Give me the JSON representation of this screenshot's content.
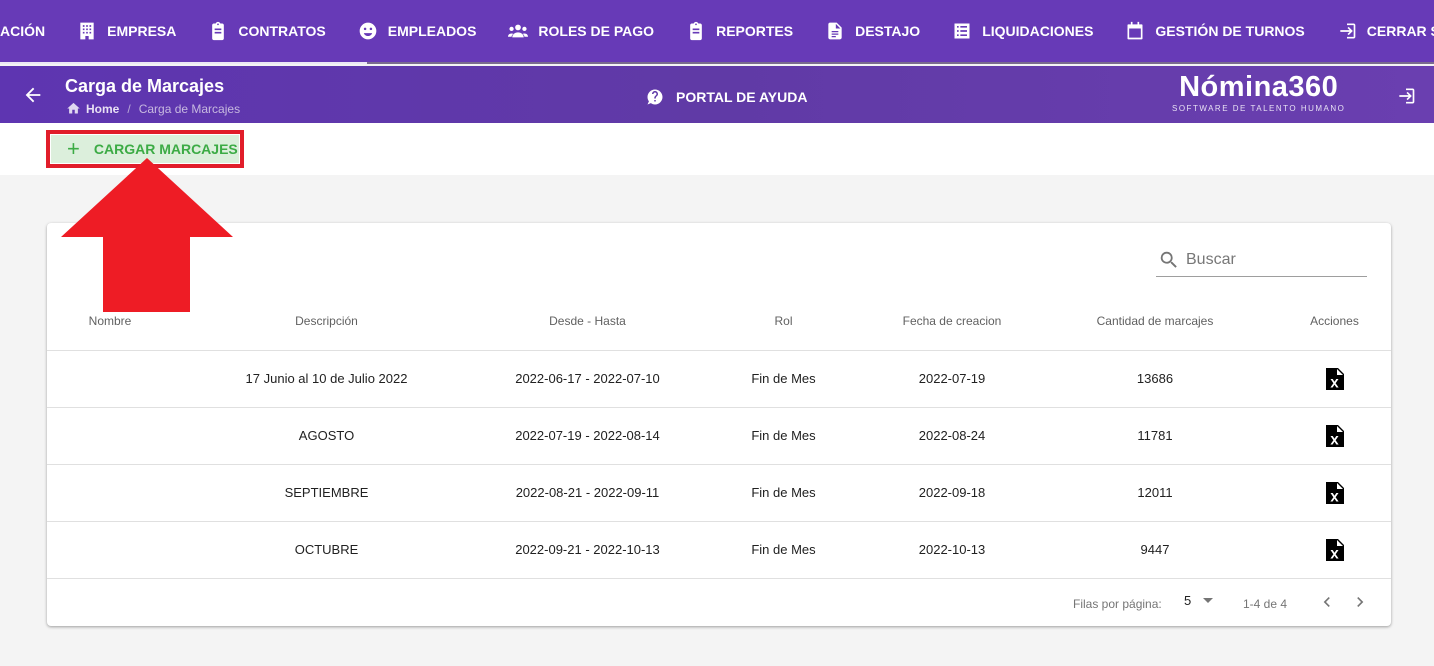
{
  "nav": {
    "items": [
      {
        "label": "ACIÓN",
        "icon": "none"
      },
      {
        "label": "EMPRESA",
        "icon": "building-icon"
      },
      {
        "label": "CONTRATOS",
        "icon": "clipboard-icon"
      },
      {
        "label": "EMPLEADOS",
        "icon": "face-icon"
      },
      {
        "label": "ROLES DE PAGO",
        "icon": "people-icon"
      },
      {
        "label": "REPORTES",
        "icon": "clipboard-icon"
      },
      {
        "label": "DESTAJO",
        "icon": "document-icon"
      },
      {
        "label": "LIQUIDACIONES",
        "icon": "list-icon"
      },
      {
        "label": "GESTIÓN DE TURNOS",
        "icon": "calendar-icon"
      },
      {
        "label": "CERRAR SESIÓN",
        "icon": "logout-icon"
      }
    ],
    "scroll_progress": 0.256
  },
  "header": {
    "title": "Carga de Marcajes",
    "breadcrumb": {
      "home": "Home",
      "current": "Carga de Marcajes"
    },
    "help_label": "PORTAL DE AYUDA",
    "brand_name": "Nómina360",
    "brand_tagline": "SOFTWARE DE TALENTO HUMANO"
  },
  "toolbar": {
    "load_label": "CARGAR MARCAJES"
  },
  "search": {
    "placeholder": "Buscar"
  },
  "table": {
    "headers": [
      "Nombre",
      "Descripción",
      "Desde - Hasta",
      "Rol",
      "Fecha de creacion",
      "Cantidad de marcajes",
      "Acciones"
    ],
    "rows": [
      {
        "nombre": "",
        "descripcion": "17 Junio al 10 de Julio 2022",
        "rango": "2022-06-17 - 2022-07-10",
        "rol": "Fin de Mes",
        "fecha": "2022-07-19",
        "cantidad": "13686"
      },
      {
        "nombre": "",
        "descripcion": "AGOSTO",
        "rango": "2022-07-19 - 2022-08-14",
        "rol": "Fin de Mes",
        "fecha": "2022-08-24",
        "cantidad": "11781"
      },
      {
        "nombre": "",
        "descripcion": "SEPTIEMBRE",
        "rango": "2022-08-21 - 2022-09-11",
        "rol": "Fin de Mes",
        "fecha": "2022-09-18",
        "cantidad": "12011"
      },
      {
        "nombre": "",
        "descripcion": "OCTUBRE",
        "rango": "2022-09-21 - 2022-10-13",
        "rol": "Fin de Mes",
        "fecha": "2022-10-13",
        "cantidad": "9447"
      }
    ]
  },
  "pagination": {
    "rows_label": "Filas por página:",
    "rows_value": "5",
    "range": "1-4 de 4"
  },
  "colors": {
    "nav_bg": "#673ab7",
    "accent_green": "#3cab45",
    "highlight_red": "#e11d2a"
  }
}
